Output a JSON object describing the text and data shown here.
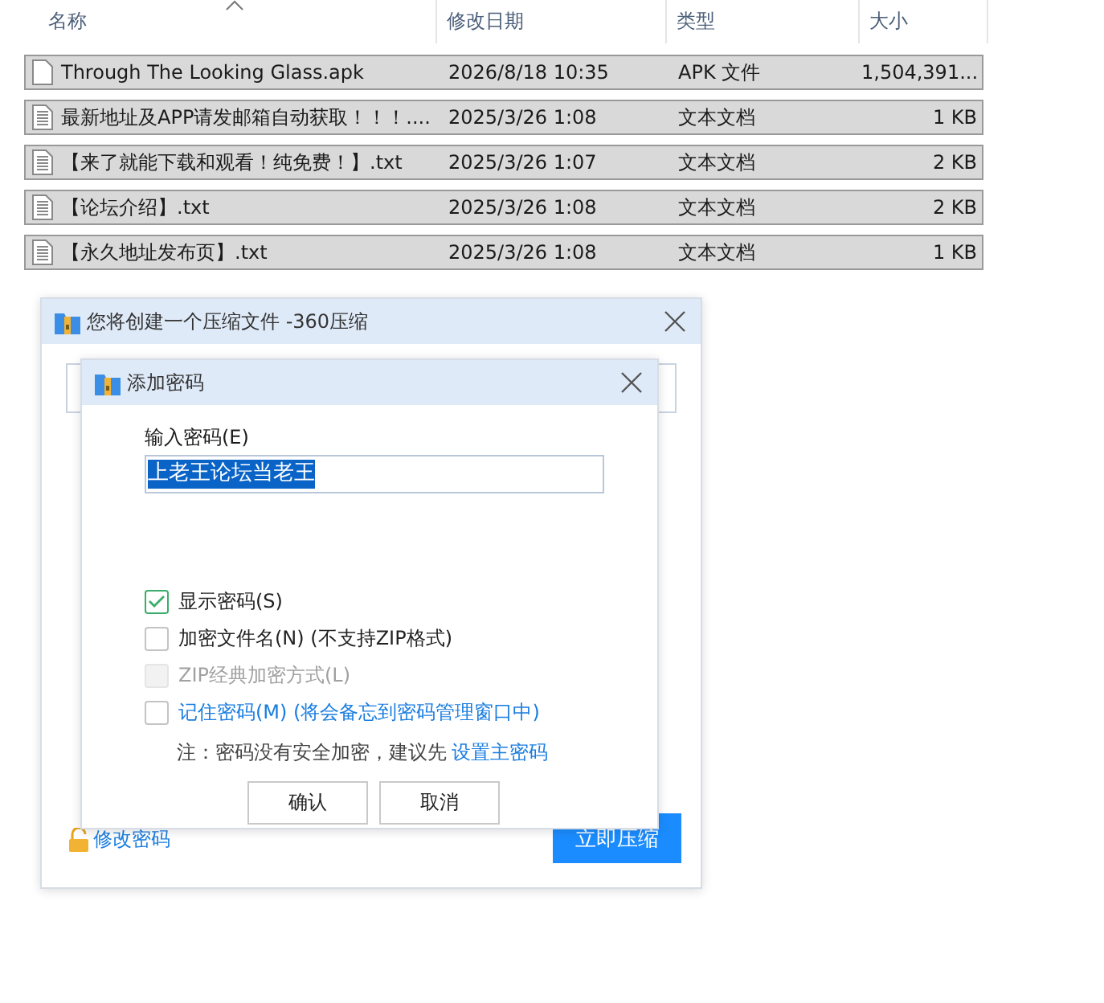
{
  "file_list": {
    "columns": [
      {
        "label": "名称",
        "sorted": true
      },
      {
        "label": "修改日期",
        "sorted": false
      },
      {
        "label": "类型",
        "sorted": false
      },
      {
        "label": "大小",
        "sorted": false
      }
    ],
    "rows": [
      {
        "kind": "blank",
        "name": "Through The Looking Glass.apk",
        "date": "2026/8/18 10:35",
        "type": "APK 文件",
        "size": "1,504,391...",
        "selected": true
      },
      {
        "kind": "text",
        "name": "最新地址及APP请发邮箱自动获取！！！....",
        "date": "2025/3/26 1:08",
        "type": "文本文档",
        "size": "1 KB",
        "selected": true
      },
      {
        "kind": "text",
        "name": "【来了就能下载和观看！纯免费！】.txt",
        "date": "2025/3/26 1:07",
        "type": "文本文档",
        "size": "2 KB",
        "selected": true
      },
      {
        "kind": "text",
        "name": "【论坛介绍】.txt",
        "date": "2025/3/26 1:08",
        "type": "文本文档",
        "size": "2 KB",
        "selected": true
      },
      {
        "kind": "text",
        "name": "【永久地址发布页】.txt",
        "date": "2025/3/26 1:08",
        "type": "文本文档",
        "size": "1 KB",
        "selected": true
      }
    ]
  },
  "compress_dialog": {
    "title": "您将创建一个压缩文件 -360压缩",
    "change_password_link": "修改密码",
    "compress_button": "立即压缩"
  },
  "password_dialog": {
    "title": "添加密码",
    "input_label": "输入密码(E)",
    "password": "上老王论坛当老王",
    "options": [
      {
        "kind": "plain",
        "label": "显示密码(S)",
        "checked": true,
        "disabled": false
      },
      {
        "kind": "plain",
        "label": "加密文件名(N) (不支持ZIP格式)",
        "checked": false,
        "disabled": false
      },
      {
        "kind": "plain",
        "label": "ZIP经典加密方式(L)",
        "checked": false,
        "disabled": true
      },
      {
        "kind": "link",
        "label": "记住密码(M) (将会备忘到密码管理窗口中)",
        "checked": false,
        "disabled": false
      }
    ],
    "note": "注：密码没有安全加密，建议先",
    "note_link": "设置主密码",
    "buttons": [
      "确认",
      "取消"
    ]
  }
}
